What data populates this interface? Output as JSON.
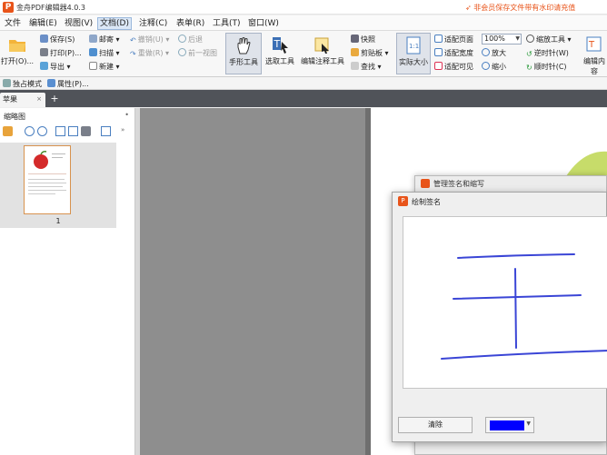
{
  "app": {
    "title": "金舟PDF编辑器4.0.3",
    "icon_letter": "P",
    "promo": "非会员保存文件带有水印请充值"
  },
  "menu": [
    "文件",
    "编辑(E)",
    "视图(V)",
    "文档(D)",
    "注释(C)",
    "表单(R)",
    "工具(T)",
    "窗口(W)"
  ],
  "menu_active_index": 3,
  "ribbon": {
    "open": "打开(O)...",
    "save": "保存(S)",
    "print": "打印(P)...",
    "export": "导出",
    "email": "邮寄",
    "scan": "扫描",
    "new": "新建",
    "undo": "撤销(U)",
    "redo": "重做(R)",
    "back": "后退",
    "forward": "前一视图",
    "hand_tool": "手形工具",
    "select_tool": "选取工具",
    "annot_tool": "编辑注释工具",
    "snapshot": "快照",
    "clipboard": "剪贴板",
    "find": "查找",
    "actual_size": "实际大小",
    "fit_page": "适配页面",
    "fit_width": "适配宽度",
    "fit_visible": "适配可见",
    "zoom_value": "100%",
    "zoom_in": "放大",
    "zoom_out": "缩小",
    "zoom_tool": "缩放工具",
    "rotate_ccw": "逆时针(W)",
    "rotate_cw": "顺时针(C)",
    "edit_content": "编辑内容"
  },
  "subbar": {
    "exclusive_mode": "独占模式",
    "properties": "属性(P)..."
  },
  "tabs": {
    "doc_tab": "苹果",
    "close": "×",
    "new": "+"
  },
  "thumbnails": {
    "title": "缩略图",
    "close": "•",
    "page_number": "1"
  },
  "dialog_back": {
    "title": "管理签名和缩写"
  },
  "dialog_front": {
    "title": "绘制签名",
    "clear_button": "清除",
    "pen_color": "#0000ff"
  },
  "colors": {
    "accent": "#e8541a",
    "ink": "#3a45d6",
    "tab_bar": "#505359"
  }
}
